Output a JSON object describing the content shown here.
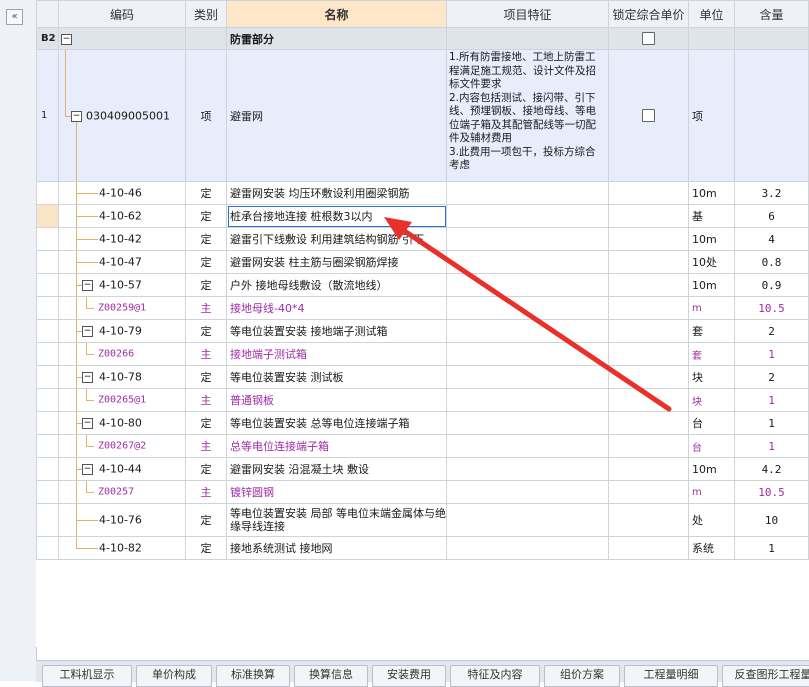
{
  "toolbar": {
    "collapse_icon": "«"
  },
  "columns": {
    "code": "编码",
    "type": "类别",
    "name": "名称",
    "feature": "项目特征",
    "lock": "锁定综合单价",
    "unit": "单位",
    "qty": "含量"
  },
  "group": {
    "row": "B2",
    "toggle": "−",
    "name": "防雷部分"
  },
  "list_item": {
    "row": "1",
    "code": "030409005001",
    "type": "项",
    "name": "避雷网",
    "feature": "1.所有防雷接地、工地上防雷工程满足施工规范、设计文件及招标文件要求\n2.内容包括测试、接闪带、引下线、预埋钢板、接地母线、等电位端子箱及其配管配线等一切配件及辅材费用\n3.此费用一项包干，投标方综合考虑",
    "unit": "项"
  },
  "rows": [
    {
      "code": "4-10-46",
      "type": "定",
      "name": "避雷网安装 均压环敷设利用圈梁钢筋",
      "unit": "10m",
      "qty": "3.2"
    },
    {
      "code": "4-10-62",
      "type": "定",
      "name": "桩承台接地连接 桩根数3以内",
      "unit": "基",
      "qty": "6"
    },
    {
      "code": "4-10-42",
      "type": "定",
      "name": "避雷引下线敷设 利用建筑结构钢筋 引下",
      "unit": "10m",
      "qty": "4"
    },
    {
      "code": "4-10-47",
      "type": "定",
      "name": "避雷网安装 柱主筋与圈梁钢筋焊接",
      "unit": "10处",
      "qty": "0.8"
    },
    {
      "code": "4-10-57",
      "type": "定",
      "name": "户外 接地母线敷设（散流地线）",
      "unit": "10m",
      "qty": "0.9"
    },
    {
      "code": "Z00259@1",
      "type": "主",
      "name": "接地母线-40*4",
      "unit": "m",
      "qty": "10.5"
    },
    {
      "code": "4-10-79",
      "type": "定",
      "name": "等电位装置安装 接地端子测试箱",
      "unit": "套",
      "qty": "2"
    },
    {
      "code": "Z00266",
      "type": "主",
      "name": "接地端子测试箱",
      "unit": "套",
      "qty": "1"
    },
    {
      "code": "4-10-78",
      "type": "定",
      "name": "等电位装置安装 测试板",
      "unit": "块",
      "qty": "2"
    },
    {
      "code": "Z00265@1",
      "type": "主",
      "name": "普通钢板",
      "unit": "块",
      "qty": "1"
    },
    {
      "code": "4-10-80",
      "type": "定",
      "name": "等电位装置安装 总等电位连接端子箱",
      "unit": "台",
      "qty": "1"
    },
    {
      "code": "Z00267@2",
      "type": "主",
      "name": "总等电位连接端子箱",
      "unit": "台",
      "qty": "1"
    },
    {
      "code": "4-10-44",
      "type": "定",
      "name": "避雷网安装 沿混凝土块 敷设",
      "unit": "10m",
      "qty": "4.2"
    },
    {
      "code": "Z00257",
      "type": "主",
      "name": "镀锌圆钢",
      "unit": "m",
      "qty": "10.5"
    },
    {
      "code": "4-10-76",
      "type": "定",
      "name": "等电位装置安装 局部 等电位末端金属体与绝缘导线连接",
      "unit": "处",
      "qty": "10"
    },
    {
      "code": "4-10-82",
      "type": "定",
      "name": "接地系统测试 接地网",
      "unit": "系统",
      "qty": "1"
    }
  ],
  "bottom_tabs": [
    "工料机显示",
    "单价构成",
    "标准换算",
    "换算信息",
    "安装费用",
    "特征及内容",
    "组价方案",
    "工程量明细",
    "反查图形工程量"
  ],
  "colors": {
    "accent_arrow": "#e8312a",
    "main_material_text": "#a02ca8",
    "header_bg": "#eef1f6",
    "name_header_bg": "#fde7c8",
    "list_row_bg": "#e7edfb"
  }
}
